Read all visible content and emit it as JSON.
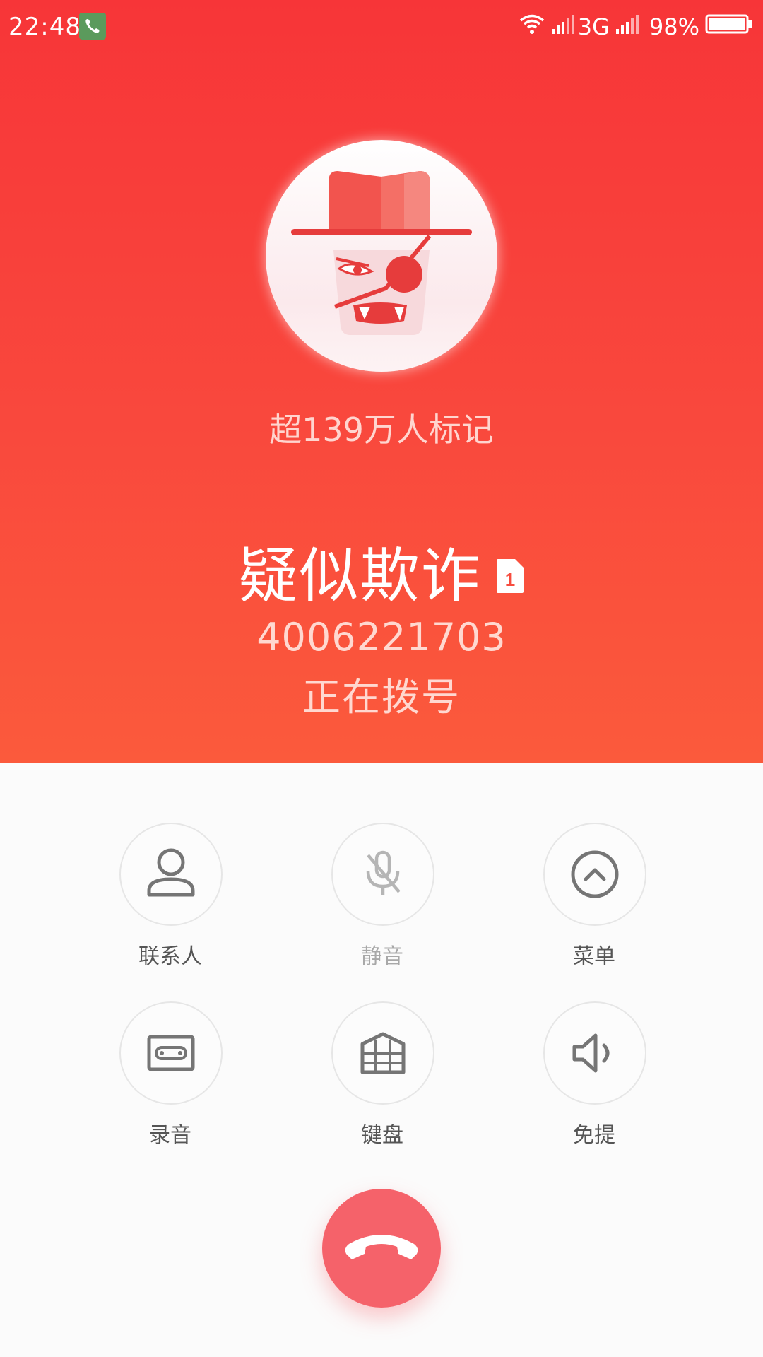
{
  "status_bar": {
    "time": "22:48",
    "network": "3G",
    "battery": "98%",
    "icons": [
      "phone-call-icon",
      "wifi-icon",
      "signal-icon",
      "signal-icon",
      "battery-icon"
    ]
  },
  "caller": {
    "avatar_icon": "fraud-bandit-icon",
    "tag_count": "超139万人标记",
    "name": "疑似欺诈",
    "sim_slot": "1",
    "number": "4006221703",
    "status": "正在拨号"
  },
  "controls": [
    {
      "label": "联系人",
      "icon": "contacts-icon",
      "enabled": true
    },
    {
      "label": "静音",
      "icon": "mute-mic-icon",
      "enabled": false
    },
    {
      "label": "菜单",
      "icon": "menu-up-icon",
      "enabled": true
    },
    {
      "label": "录音",
      "icon": "record-icon",
      "enabled": true
    },
    {
      "label": "键盘",
      "icon": "keypad-icon",
      "enabled": true
    },
    {
      "label": "免提",
      "icon": "speaker-icon",
      "enabled": true
    }
  ],
  "end_call": {
    "icon": "end-call-icon"
  },
  "colors": {
    "header_top": "#f73538",
    "header_bottom": "#fb5a3c",
    "end_call": "#f5626a",
    "icon": "#757575"
  }
}
